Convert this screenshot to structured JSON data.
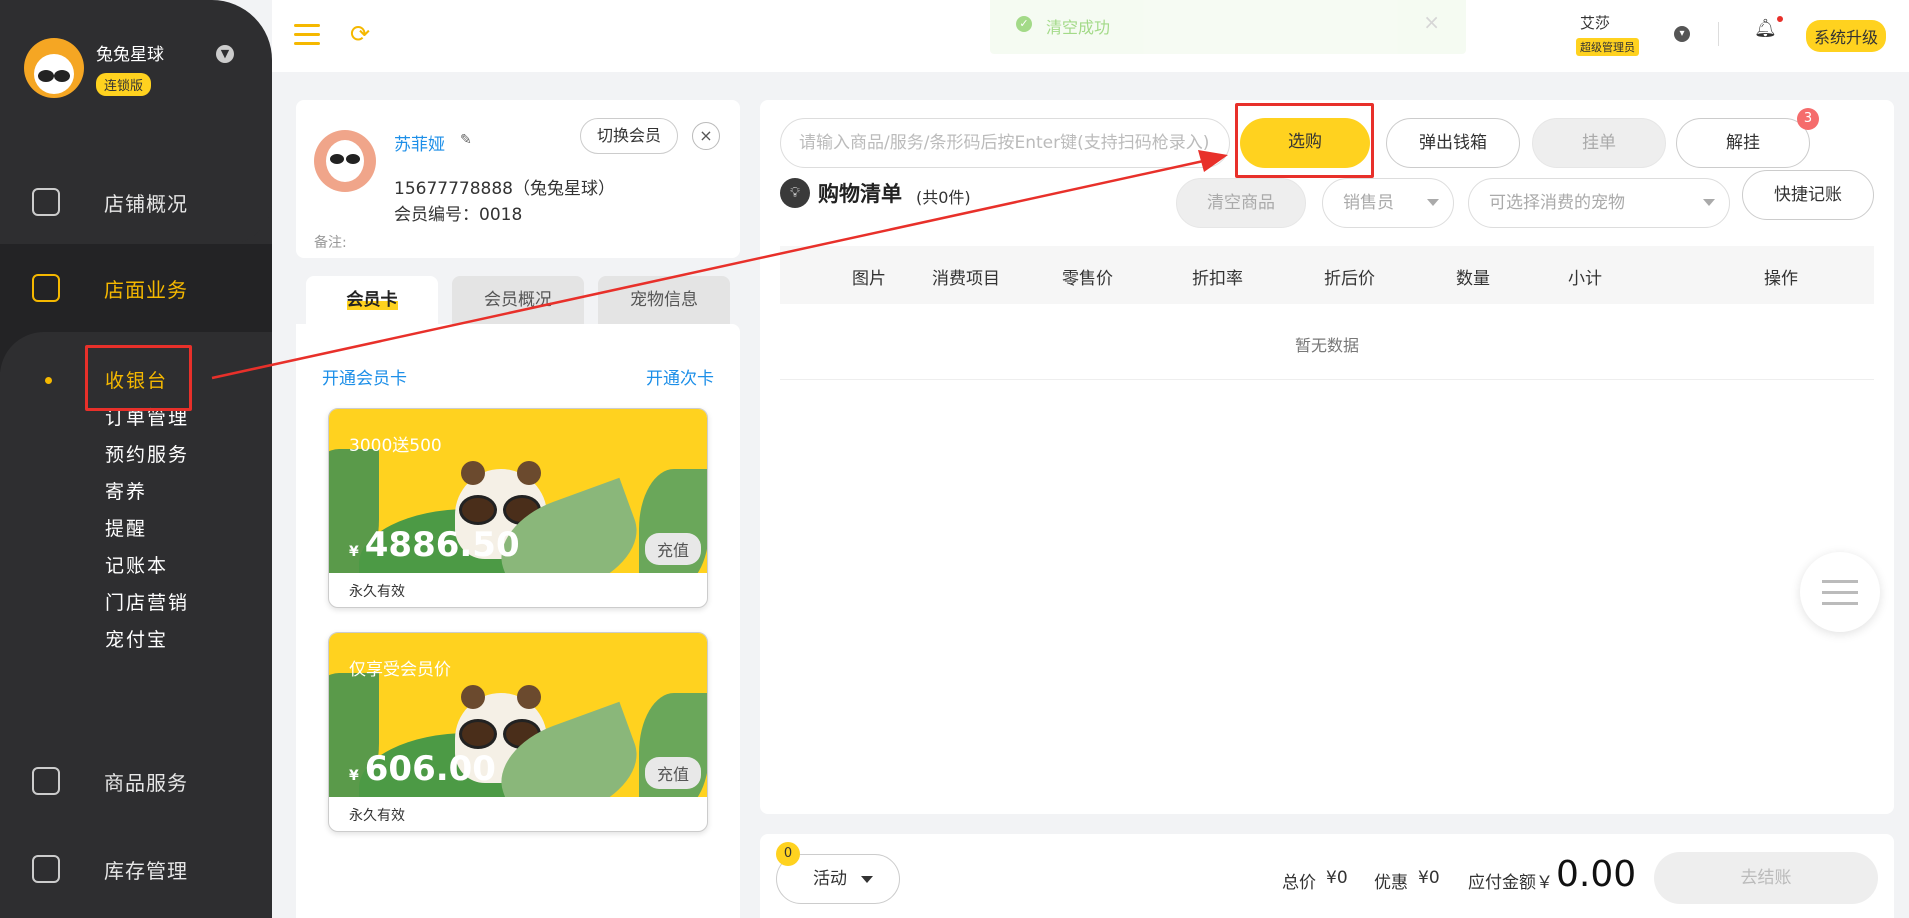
{
  "sidebar": {
    "brand_name": "兔兔星球",
    "brand_badge": "连锁版",
    "nav": {
      "overview": "店铺概况",
      "store_business": "店面业务",
      "goods": "商品服务",
      "inventory": "库存管理"
    },
    "sub_items": [
      "收银台",
      "订单管理",
      "预约服务",
      "寄养",
      "提醒",
      "记账本",
      "门店营销",
      "宠付宝"
    ]
  },
  "header": {
    "toast": "清空成功",
    "user_name": "艾莎",
    "user_role": "超级管理员",
    "upgrade": "系统升级"
  },
  "member": {
    "name": "苏菲娅",
    "switch_label": "切换会员",
    "phone": "15677778888（兔兔星球）",
    "member_no": "会员编号：0018",
    "note_label": "备注:",
    "tabs": [
      "会员卡",
      "会员概况",
      "宠物信息"
    ],
    "open_card": "开通会员卡",
    "open_times_card": "开通次卡",
    "cards": [
      {
        "title": "3000送500",
        "currency": "¥",
        "amount": "4886.50",
        "recharge": "充值",
        "validity": "永久有效"
      },
      {
        "title": "仅享受会员价",
        "currency": "¥",
        "amount": "606.00",
        "recharge": "充值",
        "validity": "永久有效"
      }
    ]
  },
  "cart": {
    "search_placeholder": "请输入商品/服务/条形码后按Enter键(支持扫码枪录入)",
    "select_button": "选购",
    "cash_drawer": "弹出钱箱",
    "hold": "挂单",
    "unhold": "解挂",
    "unhold_badge": "3",
    "title": "购物清单",
    "count": "(共0件)",
    "clear": "清空商品",
    "salesperson": "销售员",
    "pet_select": "可选择消费的宠物",
    "quick_note": "快捷记账",
    "columns": [
      "图片",
      "消费项目",
      "零售价",
      "折扣率",
      "折后价",
      "数量",
      "小计",
      "操作"
    ],
    "empty": "暂无数据"
  },
  "footer": {
    "activity_badge": "0",
    "activity": "活动",
    "total_label": "总价",
    "total_value": "¥0",
    "discount_label": "优惠",
    "discount_value": "¥0",
    "payable_label": "应付金额￥",
    "payable_value": "0.00",
    "checkout": "去结账"
  },
  "colors": {
    "accent": "#ffd21f",
    "sidebar": "#2e2e30",
    "link": "#1d8fe8",
    "annotation": "#e8302a"
  }
}
